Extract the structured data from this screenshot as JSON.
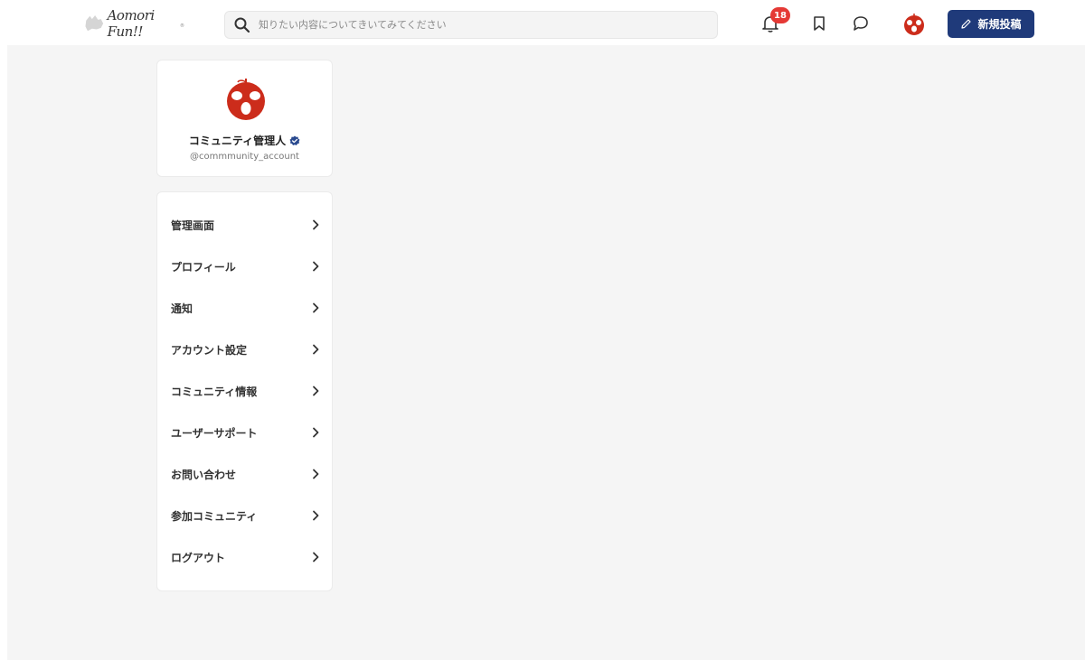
{
  "header": {
    "logo_text": "Aomori Fun!!",
    "search_placeholder": "知りたい内容についてきいてみてください",
    "notification_count": "18",
    "new_post_label": "新規投稿",
    "accent_color": "#1f3a7a",
    "badge_color": "#e53935"
  },
  "profile": {
    "name": "コミュニティ管理人",
    "handle": "@commmunity_account",
    "avatar_color": "#cc2c1b"
  },
  "menu": {
    "items": [
      {
        "label": "管理画面"
      },
      {
        "label": "プロフィール"
      },
      {
        "label": "通知"
      },
      {
        "label": "アカウント設定"
      },
      {
        "label": "コミュニティ情報"
      },
      {
        "label": "ユーザーサポート"
      },
      {
        "label": "お問い合わせ"
      },
      {
        "label": "参加コミュニティ"
      },
      {
        "label": "ログアウト"
      }
    ]
  },
  "icons": [
    "search-icon",
    "bell-icon",
    "bookmark-icon",
    "chat-icon",
    "pencil-icon",
    "verified-icon",
    "chevron-right-icon"
  ]
}
